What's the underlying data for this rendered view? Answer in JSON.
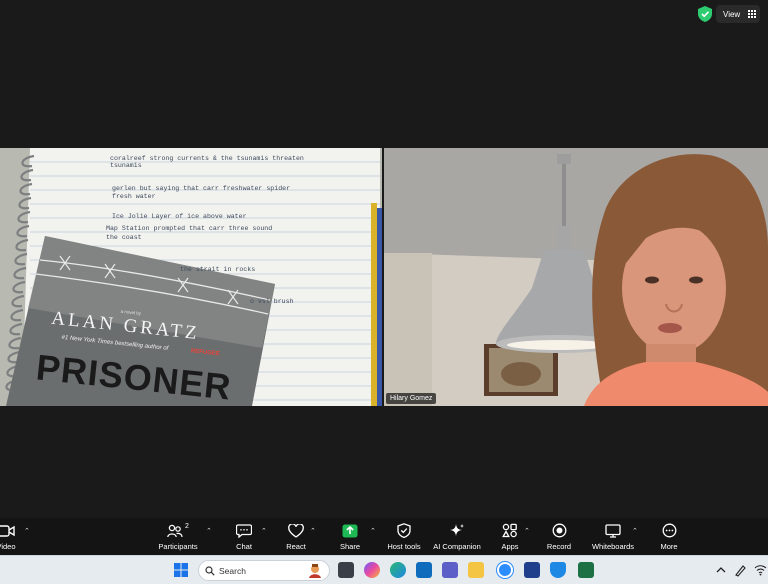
{
  "topbar": {
    "view_label": "View"
  },
  "participants": [
    {
      "name": ""
    },
    {
      "name": "Hilary Gomez"
    }
  ],
  "book": {
    "tagline": "a novel by",
    "author": "ALAN GRATZ",
    "byline": "#1 New York Times bestselling author of",
    "byline_title": "REFUGEE",
    "title": "PRISONER"
  },
  "notebook_lines": [
    "coralreef   strong currents & the tsunamis threaten",
    "tsunamis",
    "gerlen    but saying that  carr freshwater spider",
    "fresh water",
    "Ice Jolie   Layer of ice above water",
    "Map Station  prompted that  carr three sound",
    "the coast",
    "            the strait in rocks",
    "            o vsl brush"
  ],
  "toolbar": {
    "video_label": "Video",
    "participants_label": "Participants",
    "participants_count": "2",
    "chat_label": "Chat",
    "react_label": "React",
    "share_label": "Share",
    "host_tools_label": "Host tools",
    "ai_companion_label": "AI Companion",
    "apps_label": "Apps",
    "record_label": "Record",
    "whiteboards_label": "Whiteboards",
    "more_label": "More"
  },
  "taskbar": {
    "search_placeholder": "Search"
  },
  "colors": {
    "share_green": "#1db954",
    "zoom_blue": "#2d8cff",
    "shield_green": "#2ecc71"
  }
}
